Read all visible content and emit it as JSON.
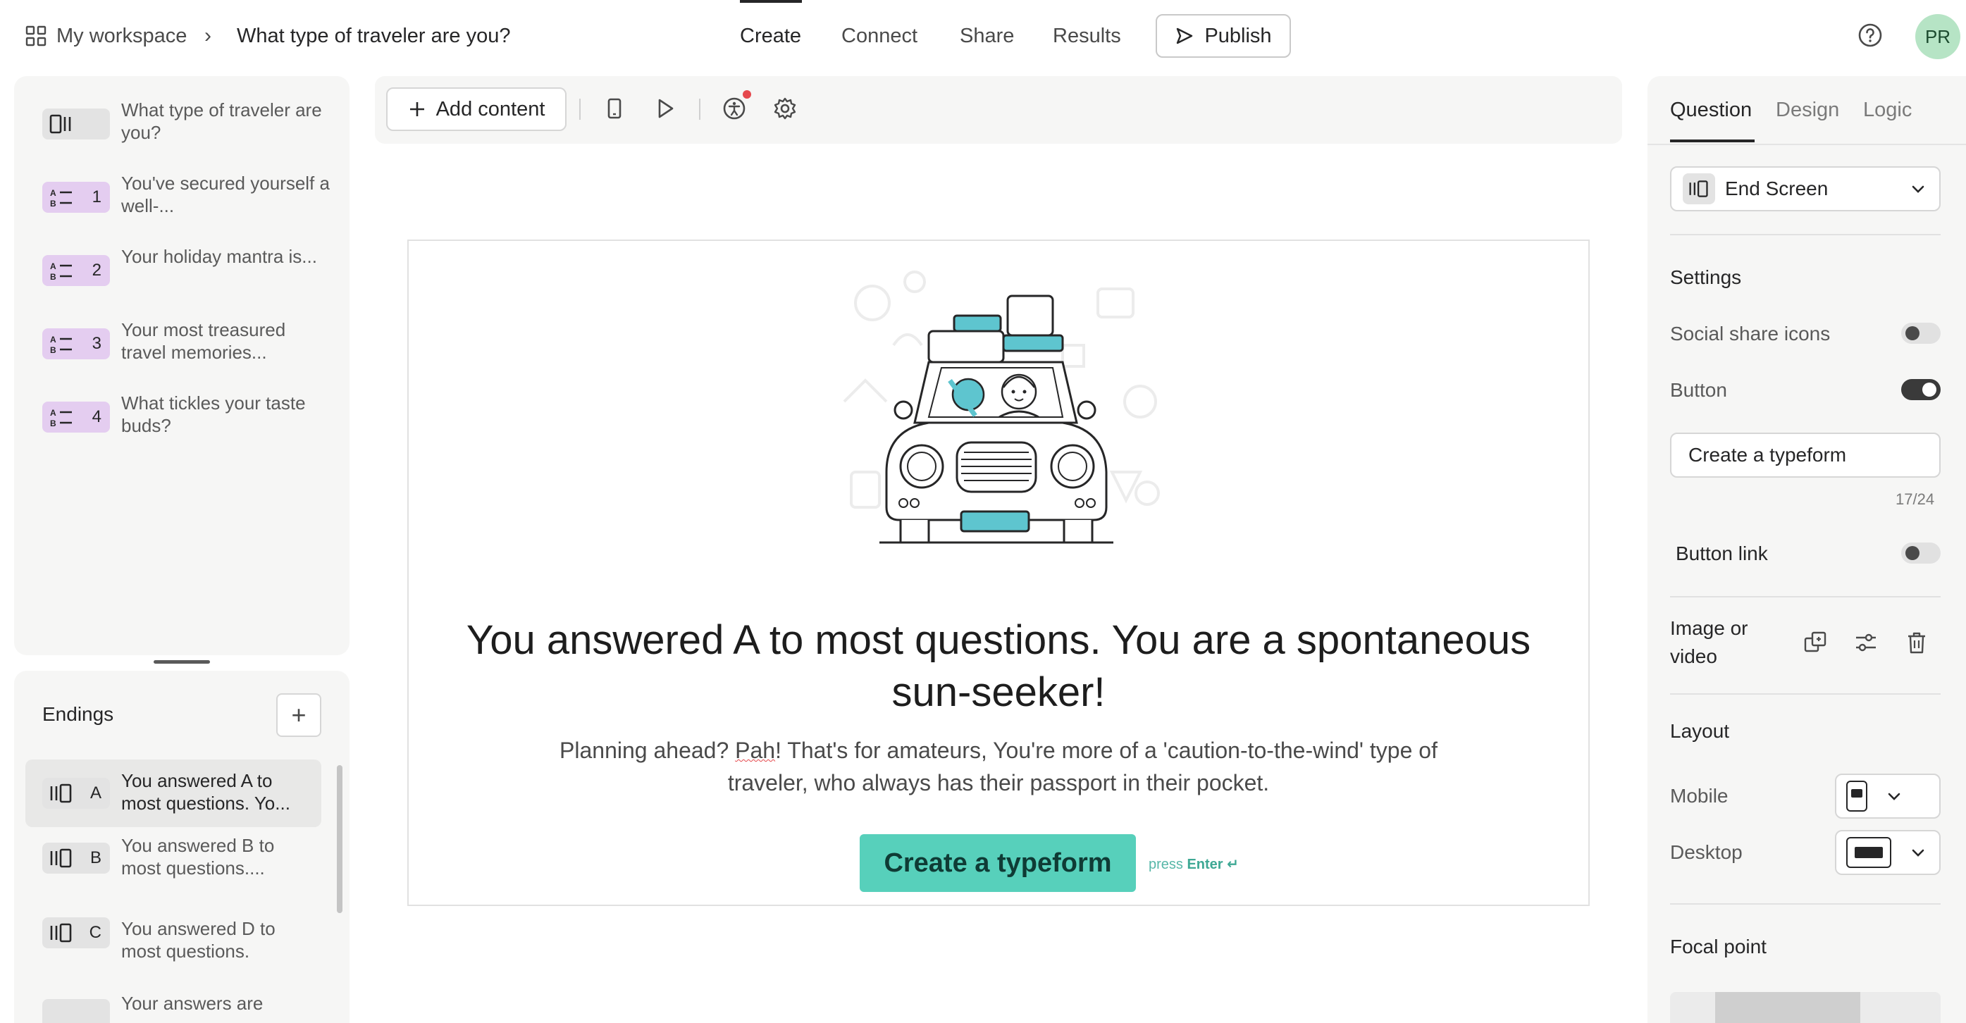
{
  "header": {
    "workspace_label": "My workspace",
    "breadcrumb_separator": "›",
    "form_title": "What type of traveler are you?",
    "nav": [
      "Create",
      "Connect",
      "Share",
      "Results"
    ],
    "publish_label": "Publish",
    "avatar_initials": "PR"
  },
  "questions": [
    {
      "num": "",
      "text": "What type of traveler are you?",
      "badge": "welcome-screen",
      "icon": "welcome-screen-icon"
    },
    {
      "num": "1",
      "text": "You've secured yourself a well-...",
      "badge": "multiple-choice",
      "icon": "multiple-choice-icon"
    },
    {
      "num": "2",
      "text": "Your holiday mantra is...",
      "badge": "multiple-choice",
      "icon": "multiple-choice-icon"
    },
    {
      "num": "3",
      "text": "Your most treasured travel memories...",
      "badge": "multiple-choice",
      "icon": "multiple-choice-icon"
    },
    {
      "num": "4",
      "text": "What tickles your taste buds?",
      "badge": "multiple-choice",
      "icon": "multiple-choice-icon"
    }
  ],
  "endings": {
    "title": "Endings",
    "add_label": "+",
    "items": [
      {
        "letter": "A",
        "text": "You answered A to most questions. Yo..."
      },
      {
        "letter": "B",
        "text": "You answered B to most questions...."
      },
      {
        "letter": "C",
        "text": "You answered D to most questions."
      },
      {
        "letter": "",
        "text": "Your answers are"
      }
    ]
  },
  "toolbar": {
    "add_content_label": "Add content",
    "icons": [
      "mobile-preview-icon",
      "play-icon",
      "accessibility-icon",
      "settings-icon"
    ]
  },
  "canvas": {
    "title": "You answered A to most questions. You are a spontaneous sun-seeker!",
    "description_pre": "Planning ahead? ",
    "description_flagged": "Pah",
    "description_post": "! That's for amateurs, You're more of a 'caution-to-the-wind' type of traveler, who always has their passport in their pocket.",
    "button_label": "Create a typeform",
    "press_label": "press",
    "enter_label": "Enter ↵",
    "accent_color": "#57d0bb"
  },
  "right_panel": {
    "tabs": [
      "Question",
      "Design",
      "Logic"
    ],
    "type_select": "End Screen",
    "settings_heading": "Settings",
    "social_share_label": "Social share icons",
    "social_share_on": false,
    "button_label": "Button",
    "button_on": true,
    "button_text_value": "Create a typeform",
    "char_count": "17/24",
    "button_link_label": "Button link",
    "button_link_on": false,
    "image_video_label": "Image or video",
    "layout_heading": "Layout",
    "mobile_label": "Mobile",
    "desktop_label": "Desktop",
    "focal_heading": "Focal point"
  }
}
